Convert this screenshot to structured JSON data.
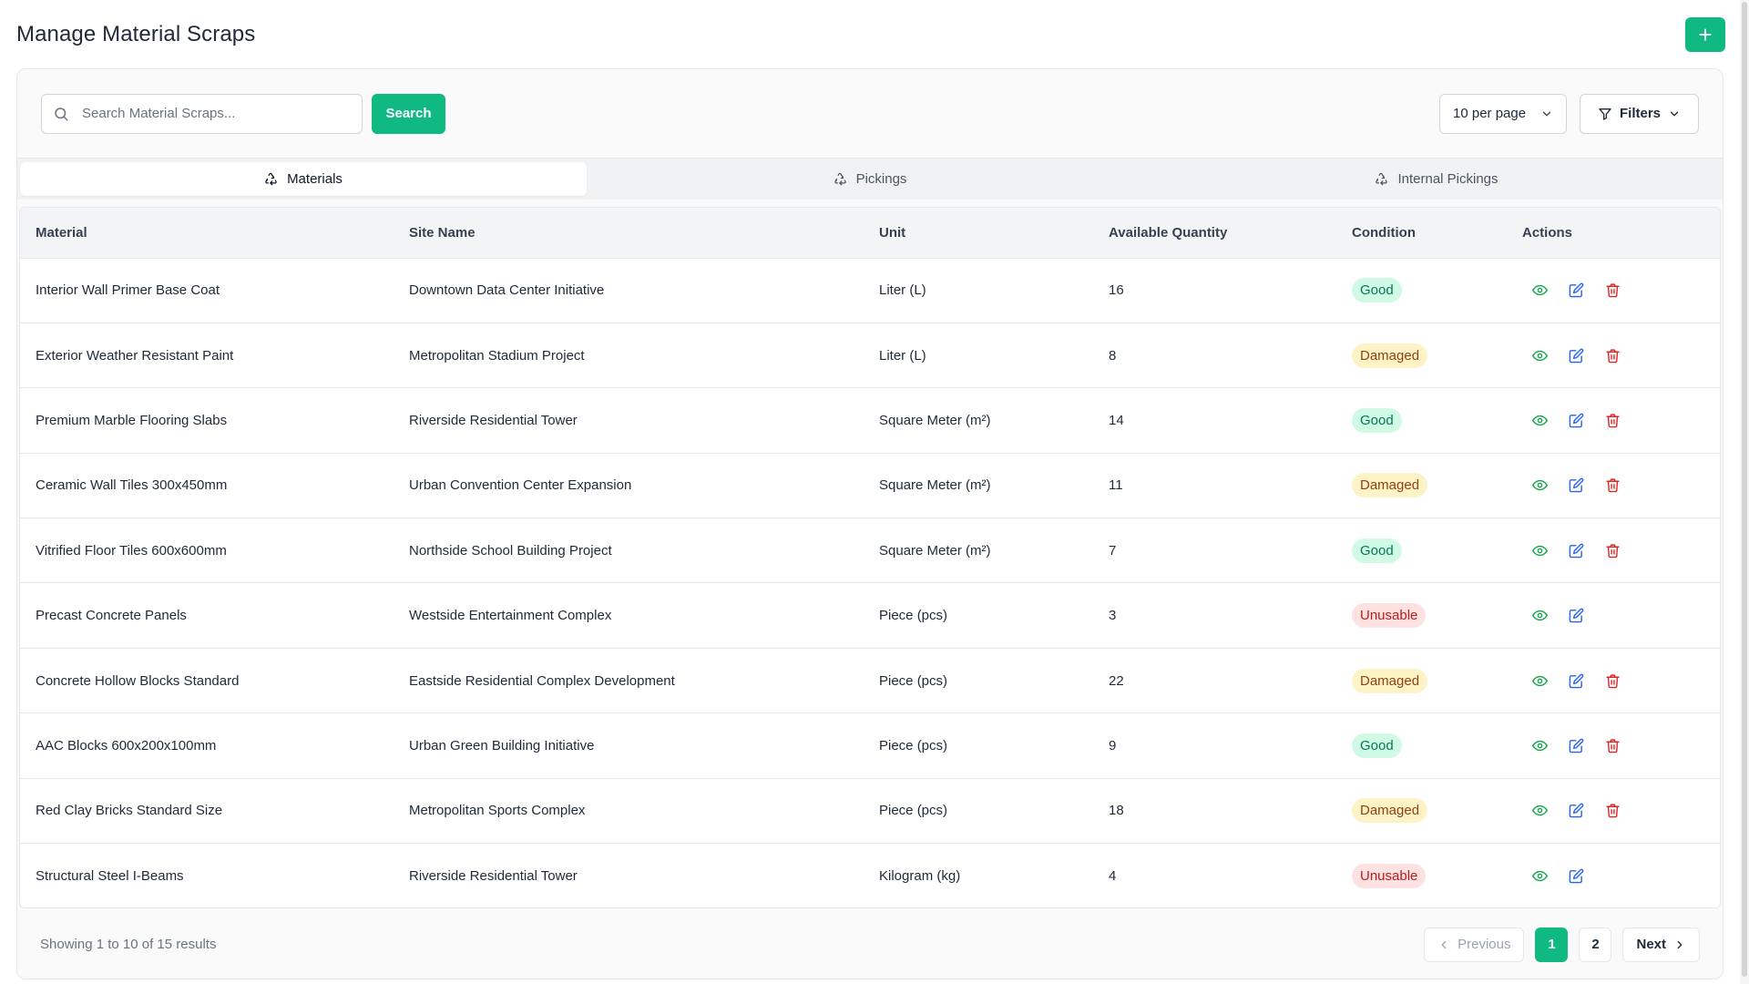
{
  "page": {
    "title": "Manage Material Scraps",
    "add_button": "+"
  },
  "toolbar": {
    "search_placeholder": "Search Material Scraps...",
    "search_value": "",
    "search_button": "Search",
    "per_page": "10 per page",
    "filters_label": "Filters"
  },
  "tabs": [
    {
      "label": "Materials",
      "active": true
    },
    {
      "label": "Pickings",
      "active": false
    },
    {
      "label": "Internal Pickings",
      "active": false
    }
  ],
  "table": {
    "columns": [
      "Material",
      "Site Name",
      "Unit",
      "Available Quantity",
      "Condition",
      "Actions"
    ],
    "rows": [
      {
        "material": "Interior Wall Primer Base Coat",
        "site": "Downtown Data Center Initiative",
        "unit": "Liter (L)",
        "qty": "16",
        "condition": "Good",
        "deletable": true
      },
      {
        "material": "Exterior Weather Resistant Paint",
        "site": "Metropolitan Stadium Project",
        "unit": "Liter (L)",
        "qty": "8",
        "condition": "Damaged",
        "deletable": true
      },
      {
        "material": "Premium Marble Flooring Slabs",
        "site": "Riverside Residential Tower",
        "unit": "Square Meter (m²)",
        "qty": "14",
        "condition": "Good",
        "deletable": true
      },
      {
        "material": "Ceramic Wall Tiles 300x450mm",
        "site": "Urban Convention Center Expansion",
        "unit": "Square Meter (m²)",
        "qty": "11",
        "condition": "Damaged",
        "deletable": true
      },
      {
        "material": "Vitrified Floor Tiles 600x600mm",
        "site": "Northside School Building Project",
        "unit": "Square Meter (m²)",
        "qty": "7",
        "condition": "Good",
        "deletable": true
      },
      {
        "material": "Precast Concrete Panels",
        "site": "Westside Entertainment Complex",
        "unit": "Piece (pcs)",
        "qty": "3",
        "condition": "Unusable",
        "deletable": false
      },
      {
        "material": "Concrete Hollow Blocks Standard",
        "site": "Eastside Residential Complex Development",
        "unit": "Piece (pcs)",
        "qty": "22",
        "condition": "Damaged",
        "deletable": true
      },
      {
        "material": "AAC Blocks 600x200x100mm",
        "site": "Urban Green Building Initiative",
        "unit": "Piece (pcs)",
        "qty": "9",
        "condition": "Good",
        "deletable": true
      },
      {
        "material": "Red Clay Bricks Standard Size",
        "site": "Metropolitan Sports Complex",
        "unit": "Piece (pcs)",
        "qty": "18",
        "condition": "Damaged",
        "deletable": true
      },
      {
        "material": "Structural Steel I-Beams",
        "site": "Riverside Residential Tower",
        "unit": "Kilogram (kg)",
        "qty": "4",
        "condition": "Unusable",
        "deletable": false
      }
    ]
  },
  "footer": {
    "results_text": "Showing 1 to 10 of 15 results",
    "previous": "Previous",
    "pages": [
      "1",
      "2"
    ],
    "current_page": "1",
    "next": "Next"
  },
  "colors": {
    "accent": "#10b981",
    "view_icon": "#16a34a",
    "edit_icon": "#2563eb",
    "delete_icon": "#dc2626"
  },
  "icons": {
    "search": "search-icon",
    "chevron": "chevron-down-icon",
    "filter": "filter-icon",
    "tab": "recycle-icon",
    "view": "eye-icon",
    "edit": "edit-icon",
    "delete": "trash-icon"
  }
}
